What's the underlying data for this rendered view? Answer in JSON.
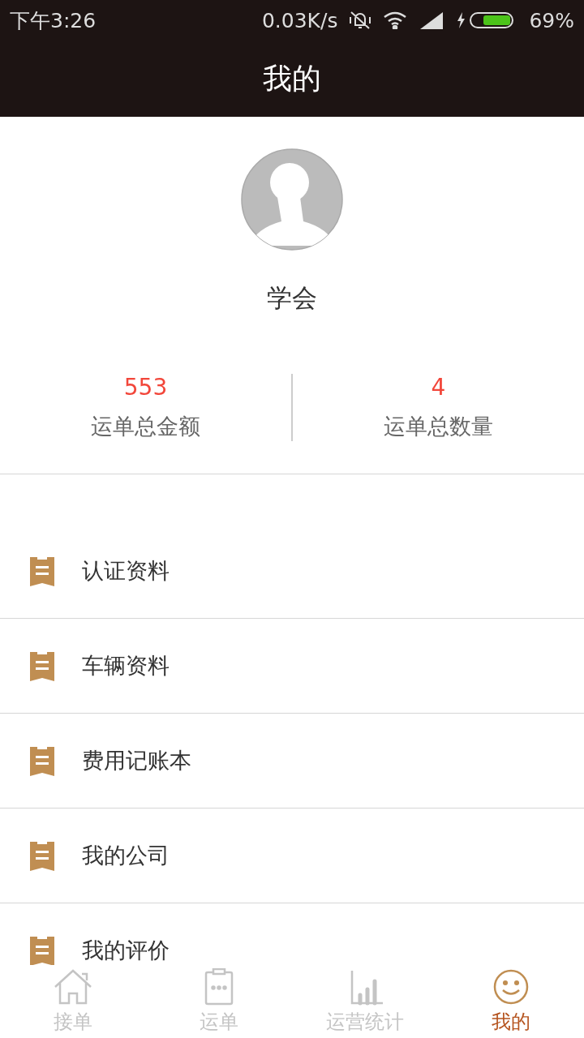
{
  "status_bar": {
    "time": "下午3:26",
    "speed": "0.03K/s",
    "battery": "69%"
  },
  "header": {
    "title": "我的"
  },
  "profile": {
    "name": "学会"
  },
  "stats": [
    {
      "value": "553",
      "label": "运单总金额"
    },
    {
      "value": "4",
      "label": "运单总数量"
    }
  ],
  "menu": [
    "认证资料",
    "车辆资料",
    "费用记账本",
    "我的公司",
    "我的评价"
  ],
  "tabs": [
    {
      "label": "接单",
      "kind": "home",
      "selected": false
    },
    {
      "label": "运单",
      "kind": "clipboard",
      "selected": false
    },
    {
      "label": "运营统计",
      "kind": "chart",
      "selected": false
    },
    {
      "label": "我的",
      "kind": "smile",
      "selected": true
    }
  ]
}
